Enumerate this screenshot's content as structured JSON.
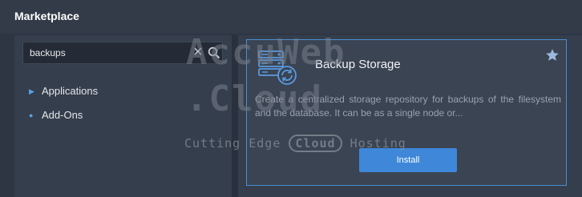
{
  "window": {
    "title": "Marketplace"
  },
  "search": {
    "value": "backups",
    "placeholder": ""
  },
  "sidebar": {
    "items": [
      {
        "label": "Applications",
        "marker": "▶"
      },
      {
        "label": "Add-Ons",
        "marker": "●"
      }
    ]
  },
  "card": {
    "name": "Backup Storage",
    "description": "Create a centralized storage repository for backups of the filesystem and the database. It can be as a single node or...",
    "install_label": "Install",
    "icon": "backup-storage-icon",
    "accent": "#3f87d8"
  },
  "watermark": {
    "line1": "AccuWeb",
    "line2": ".Cloud",
    "tag_pre": "Cutting Edge",
    "tag_cloud": "Cloud",
    "tag_post": "Hosting"
  }
}
